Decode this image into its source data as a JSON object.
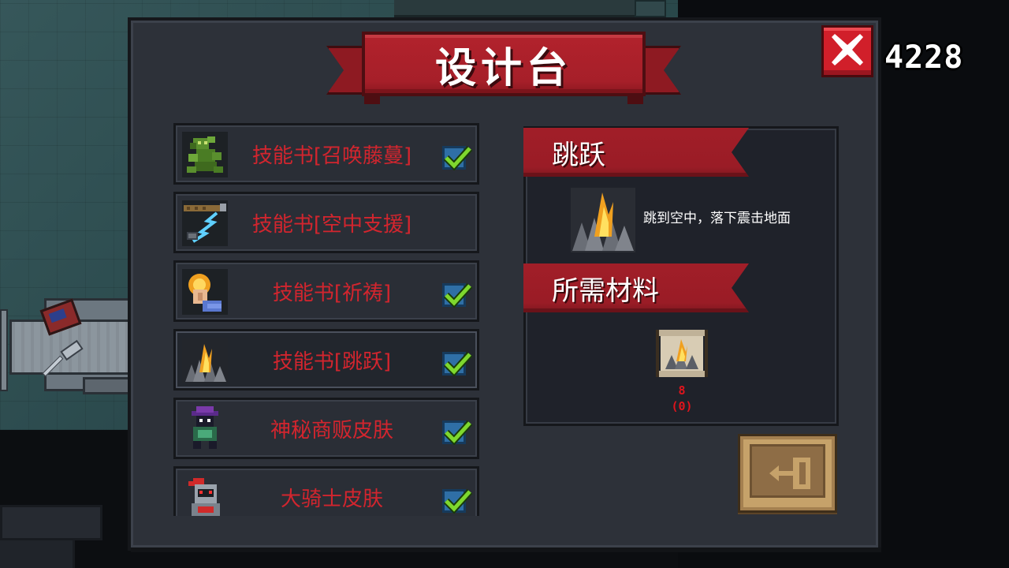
{
  "window": {
    "title": "设计台"
  },
  "currency": {
    "gems": "4228"
  },
  "recipes": [
    {
      "label": "技能书[召唤藤蔓]",
      "checked": true,
      "icon": "vine-summon-icon"
    },
    {
      "label": "技能书[空中支援]",
      "checked": false,
      "icon": "air-support-icon"
    },
    {
      "label": "技能书[祈祷]",
      "checked": true,
      "icon": "prayer-icon"
    },
    {
      "label": "技能书[跳跃]",
      "checked": true,
      "icon": "jump-icon",
      "selected": true
    },
    {
      "label": "神秘商贩皮肤",
      "checked": true,
      "icon": "mystery-merchant-skin-icon"
    },
    {
      "label": "大骑士皮肤",
      "checked": true,
      "icon": "grand-knight-skin-icon"
    }
  ],
  "detail": {
    "skill_name": "跳跃",
    "description": "跳到空中，落下震击地面",
    "materials_label": "所需材料",
    "materials": [
      {
        "icon": "jump-scroll-icon",
        "required": "8",
        "owned": "(0)"
      }
    ]
  },
  "colors": {
    "accent_red": "#d2252e",
    "ribbon_red": "#a61f29",
    "check_green": "#7ed82e",
    "check_box_blue": "#2f6fa6",
    "panel_bg": "#2d3139",
    "craft_gold": "#c6a26a"
  }
}
